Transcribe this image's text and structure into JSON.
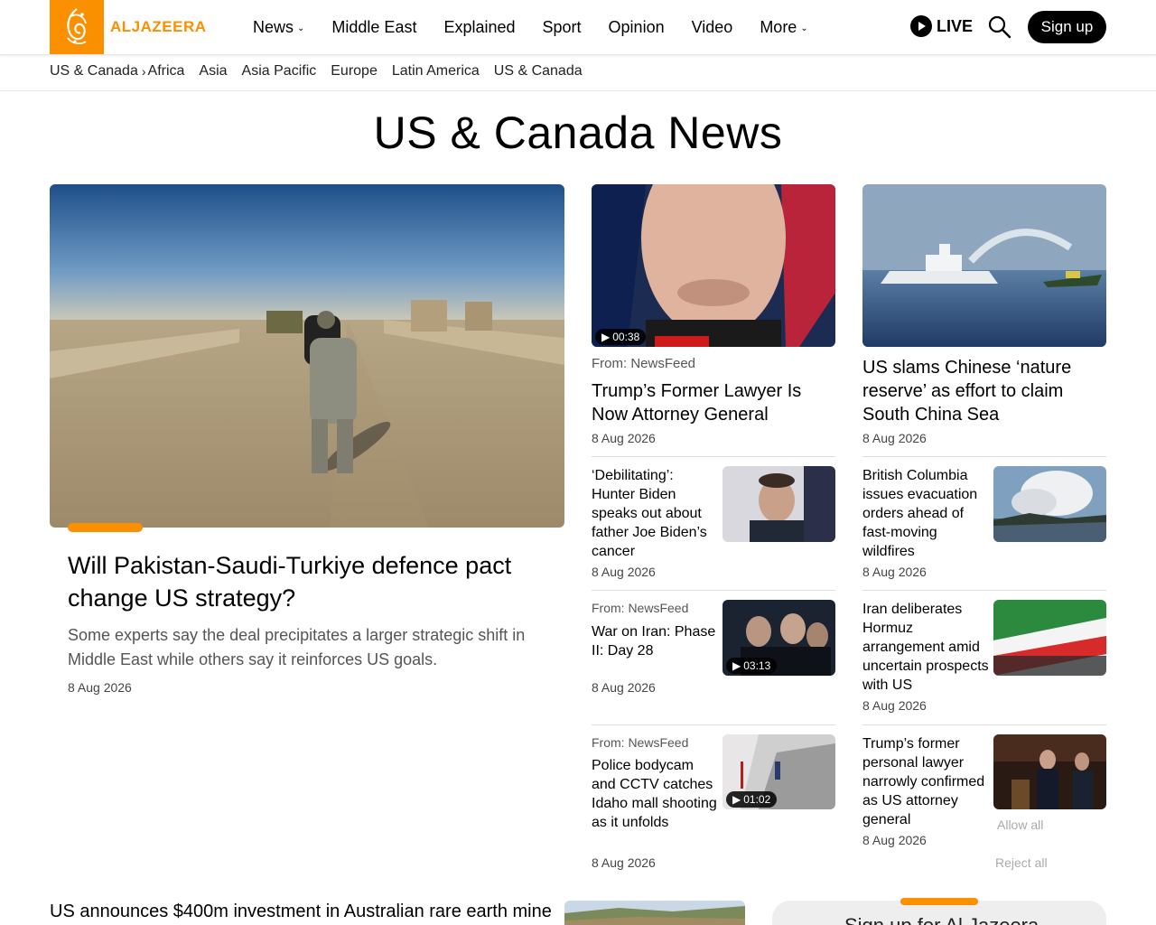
{
  "header": {
    "logo_text": "ALJAZEERA",
    "nav": [
      {
        "label": "News",
        "has_dropdown": true
      },
      {
        "label": "Middle East",
        "has_dropdown": false
      },
      {
        "label": "Explained",
        "has_dropdown": false
      },
      {
        "label": "Sport",
        "has_dropdown": false
      },
      {
        "label": "Opinion",
        "has_dropdown": false
      },
      {
        "label": "Video",
        "has_dropdown": false
      },
      {
        "label": "More",
        "has_dropdown": true
      }
    ],
    "live_label": "LIVE",
    "signup_label": "Sign up",
    "accent_color": "#fa9000"
  },
  "subnav": {
    "current": "US & Canada",
    "links": [
      "Africa",
      "Asia",
      "Asia Pacific",
      "Europe",
      "Latin America",
      "US & Canada"
    ]
  },
  "page_title": "US & Canada News",
  "hero": {
    "title": "Will Pakistan-Saudi-Turkiye defence pact change US strategy?",
    "description": "Some experts say the deal precipitates a larger strategic shift in Middle East while others say it reinforces US goals.",
    "date": "8 Aug 2026"
  },
  "col2": {
    "top": {
      "from": "From: NewsFeed",
      "title": "Trump’s Former Lawyer Is Now Attorney General",
      "date": "8 Aug 2026",
      "duration": "00:38"
    },
    "items": [
      {
        "from": "",
        "title": "‘Debilitating’: Hunter Biden speaks out about father Joe Biden’s cancer",
        "date": "8 Aug 2026",
        "duration": ""
      },
      {
        "from": "From: NewsFeed",
        "title": "War on Iran: Phase II: Day 28",
        "date": "8 Aug 2026",
        "duration": "03:13"
      },
      {
        "from": "From: NewsFeed",
        "title": "Police bodycam and CCTV catches Idaho mall shooting as it unfolds",
        "date": "8 Aug 2026",
        "duration": "01:02"
      }
    ]
  },
  "col3": {
    "top": {
      "title": "US slams Chinese ‘nature reserve’ as effort to claim South China Sea",
      "date": "8 Aug 2026"
    },
    "items": [
      {
        "title": "British Columbia issues evacuation orders ahead of fast-moving wildfires",
        "date": "8 Aug 2026"
      },
      {
        "title": "Iran deliberates Hormuz arrangement amid uncertain prospects with US",
        "date": "8 Aug 2026"
      },
      {
        "title": "Trump’s former personal lawyer narrowly confirmed as US attorney general",
        "date": "8 Aug 2026"
      }
    ]
  },
  "cookie": {
    "allow_all": "Allow all",
    "reject_all": "Reject all"
  },
  "bottom": {
    "title": "US announces $400m investment in Australian rare earth mine",
    "newsletter_text": "Sign up for Al Jazeera"
  }
}
